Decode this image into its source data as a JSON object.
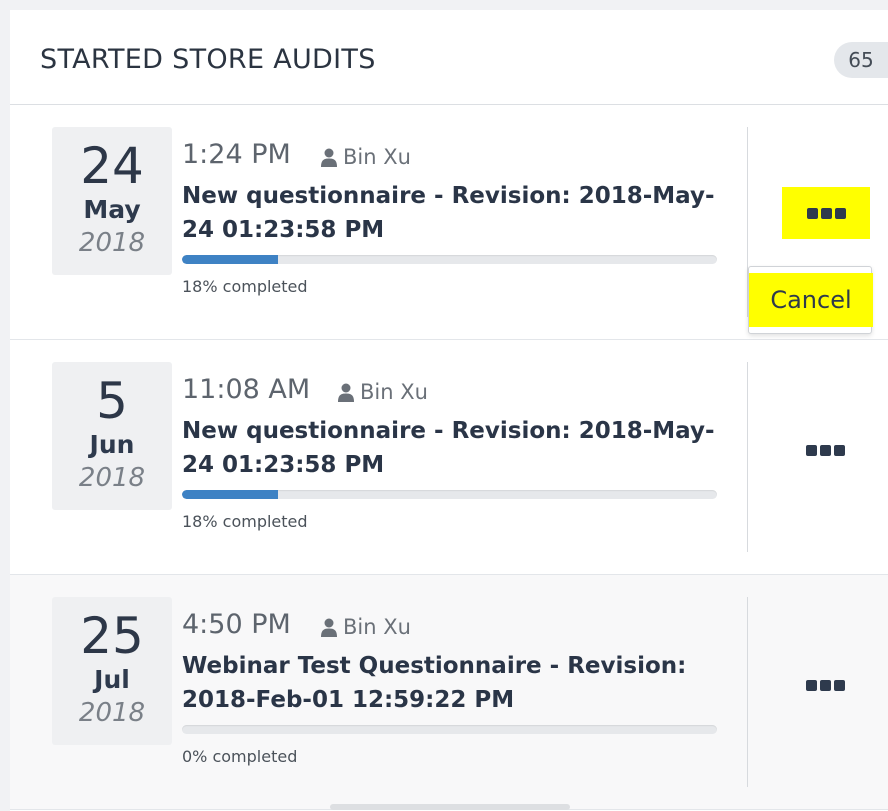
{
  "panel": {
    "title": "STARTED STORE AUDITS",
    "count": "65"
  },
  "audits": [
    {
      "day": "24",
      "month": "May",
      "year": "2018",
      "time": "1:24 PM",
      "user": "Bin Xu",
      "questionnaire": "New questionnaire - Revision: 2018-May-24 01:23:58 PM",
      "progress": 18,
      "progress_label": "18% completed"
    },
    {
      "day": "5",
      "month": "Jun",
      "year": "2018",
      "time": "11:08 AM",
      "user": "Bin Xu",
      "questionnaire": "New questionnaire - Revision: 2018-May-24 01:23:58 PM",
      "progress": 18,
      "progress_label": "18% completed"
    },
    {
      "day": "25",
      "month": "Jul",
      "year": "2018",
      "time": "4:50 PM",
      "user": "Bin Xu",
      "questionnaire": "Webinar Test Questionnaire - Revision: 2018-Feb-01 12:59:22 PM",
      "progress": 0,
      "progress_label": "0% completed"
    }
  ],
  "menu": {
    "cancel_label": "Cancel"
  },
  "icons": {
    "user": "user-icon",
    "more": "more-options-icon"
  },
  "colors": {
    "highlight": "#ffff00",
    "progress": "#3e82c4"
  }
}
